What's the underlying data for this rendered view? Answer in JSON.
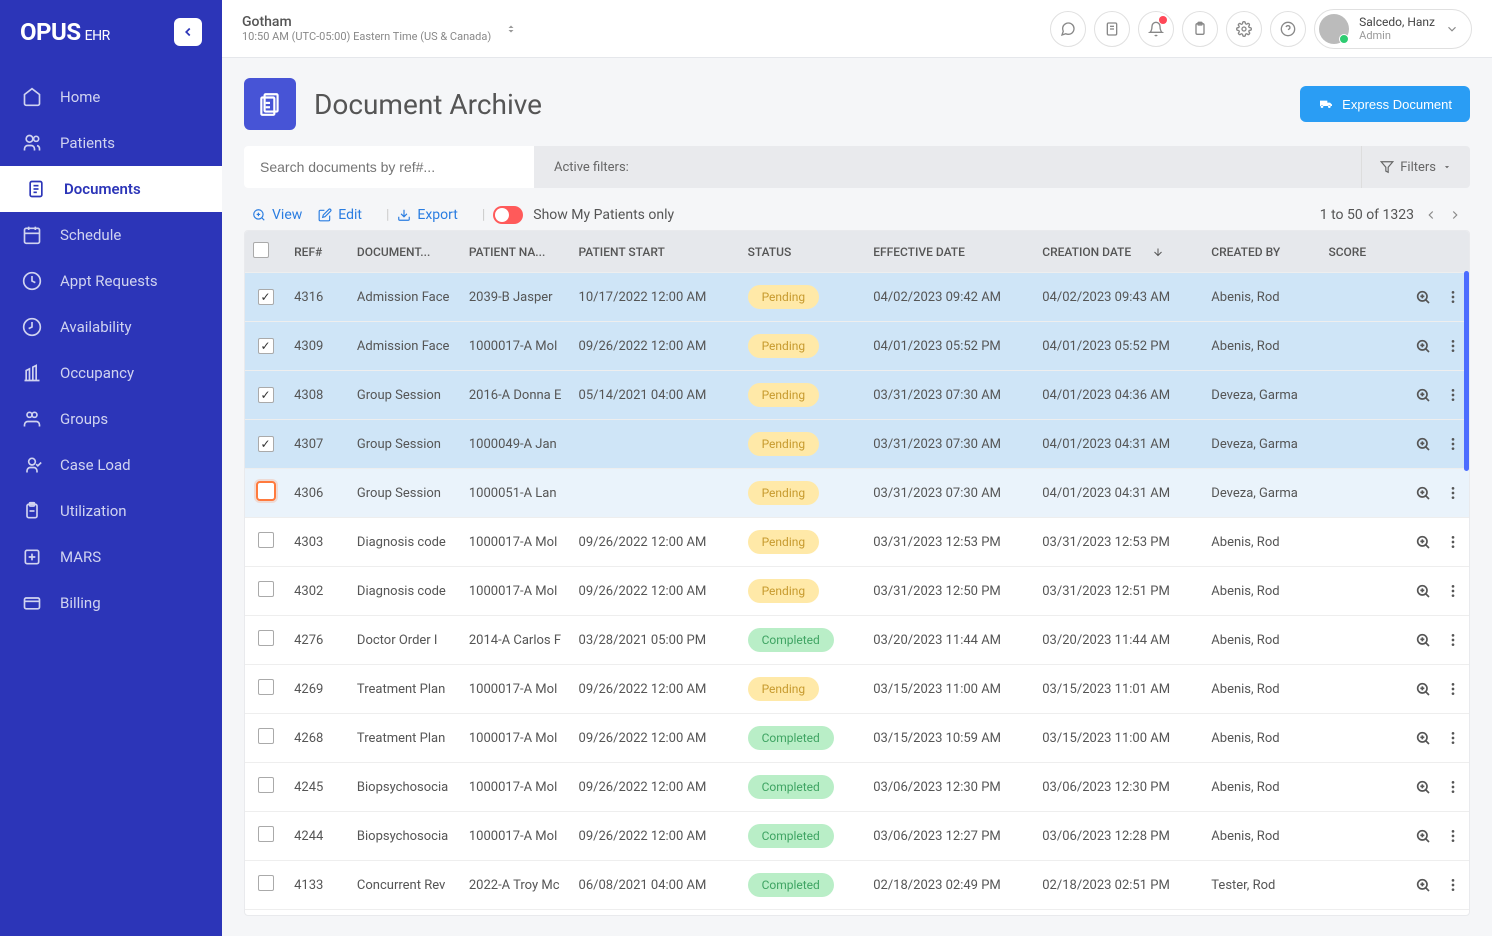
{
  "brand": {
    "name": "OPUS",
    "sub": "EHR"
  },
  "sidebar": {
    "items": [
      {
        "label": "Home"
      },
      {
        "label": "Patients"
      },
      {
        "label": "Documents"
      },
      {
        "label": "Schedule"
      },
      {
        "label": "Appt Requests"
      },
      {
        "label": "Availability"
      },
      {
        "label": "Occupancy"
      },
      {
        "label": "Groups"
      },
      {
        "label": "Case Load"
      },
      {
        "label": "Utilization"
      },
      {
        "label": "MARS"
      },
      {
        "label": "Billing"
      }
    ]
  },
  "topbar": {
    "location": "Gotham",
    "time": "10:50 AM (UTC-05:00) Eastern Time (US & Canada)",
    "user_name": "Salcedo, Hanz",
    "user_role": "Admin"
  },
  "page": {
    "title": "Document Archive",
    "express_btn": "Express Document",
    "search_placeholder": "Search documents by ref#...",
    "active_filters": "Active filters:",
    "filters_btn": "Filters"
  },
  "toolbar": {
    "view": "View",
    "edit": "Edit",
    "export": "Export",
    "toggle_label": "Show My Patients only",
    "pager": "1 to 50 of 1323"
  },
  "columns": {
    "ref": "REF#",
    "doc": "DOCUMENT...",
    "patient": "PATIENT NA...",
    "start": "PATIENT START",
    "status": "STATUS",
    "eff": "EFFECTIVE DATE",
    "creat": "CREATION DATE",
    "by": "CREATED BY",
    "score": "SCORE"
  },
  "rows": [
    {
      "selected": true,
      "ref": "4316",
      "doc": "Admission Face",
      "patient": "2039-B Jasper",
      "start": "10/17/2022 12:00 AM",
      "status": "Pending",
      "eff": "04/02/2023 09:42 AM",
      "creat": "04/02/2023 09:43 AM",
      "by": "Abenis, Rod"
    },
    {
      "selected": true,
      "ref": "4309",
      "doc": "Admission Face",
      "patient": "1000017-A Mol",
      "start": "09/26/2022 12:00 AM",
      "status": "Pending",
      "eff": "04/01/2023 05:52 PM",
      "creat": "04/01/2023 05:52 PM",
      "by": "Abenis, Rod"
    },
    {
      "selected": true,
      "ref": "4308",
      "doc": "Group Session",
      "patient": "2016-A Donna E",
      "start": "05/14/2021 04:00 AM",
      "status": "Pending",
      "eff": "03/31/2023 07:30 AM",
      "creat": "04/01/2023 04:36 AM",
      "by": "Deveza, Garma"
    },
    {
      "selected": true,
      "ref": "4307",
      "doc": "Group Session",
      "patient": "1000049-A Jan",
      "start": "",
      "status": "Pending",
      "eff": "03/31/2023 07:30 AM",
      "creat": "04/01/2023 04:31 AM",
      "by": "Deveza, Garma"
    },
    {
      "selected": false,
      "hl": true,
      "ref": "4306",
      "doc": "Group Session",
      "patient": "1000051-A Lan",
      "start": "",
      "status": "Pending",
      "eff": "03/31/2023 07:30 AM",
      "creat": "04/01/2023 04:31 AM",
      "by": "Deveza, Garma"
    },
    {
      "selected": false,
      "ref": "4303",
      "doc": "Diagnosis code",
      "patient": "1000017-A Mol",
      "start": "09/26/2022 12:00 AM",
      "status": "Pending",
      "eff": "03/31/2023 12:53 PM",
      "creat": "03/31/2023 12:53 PM",
      "by": "Abenis, Rod"
    },
    {
      "selected": false,
      "ref": "4302",
      "doc": "Diagnosis code",
      "patient": "1000017-A Mol",
      "start": "09/26/2022 12:00 AM",
      "status": "Pending",
      "eff": "03/31/2023 12:50 PM",
      "creat": "03/31/2023 12:51 PM",
      "by": "Abenis, Rod"
    },
    {
      "selected": false,
      "ref": "4276",
      "doc": "Doctor Order I",
      "patient": "2014-A Carlos F",
      "start": "03/28/2021 05:00 PM",
      "status": "Completed",
      "eff": "03/20/2023 11:44 AM",
      "creat": "03/20/2023 11:44 AM",
      "by": "Abenis, Rod"
    },
    {
      "selected": false,
      "ref": "4269",
      "doc": "Treatment Plan",
      "patient": "1000017-A Mol",
      "start": "09/26/2022 12:00 AM",
      "status": "Pending",
      "eff": "03/15/2023 11:00 AM",
      "creat": "03/15/2023 11:01 AM",
      "by": "Abenis, Rod"
    },
    {
      "selected": false,
      "ref": "4268",
      "doc": "Treatment Plan",
      "patient": "1000017-A Mol",
      "start": "09/26/2022 12:00 AM",
      "status": "Completed",
      "eff": "03/15/2023 10:59 AM",
      "creat": "03/15/2023 11:00 AM",
      "by": "Abenis, Rod"
    },
    {
      "selected": false,
      "ref": "4245",
      "doc": "Biopsychosocia",
      "patient": "1000017-A Mol",
      "start": "09/26/2022 12:00 AM",
      "status": "Completed",
      "eff": "03/06/2023 12:30 PM",
      "creat": "03/06/2023 12:30 PM",
      "by": "Abenis, Rod"
    },
    {
      "selected": false,
      "ref": "4244",
      "doc": "Biopsychosocia",
      "patient": "1000017-A Mol",
      "start": "09/26/2022 12:00 AM",
      "status": "Completed",
      "eff": "03/06/2023 12:27 PM",
      "creat": "03/06/2023 12:28 PM",
      "by": "Abenis, Rod"
    },
    {
      "selected": false,
      "ref": "4133",
      "doc": "Concurrent Rev",
      "patient": "2022-A Troy Mc",
      "start": "06/08/2021 04:00 AM",
      "status": "Completed",
      "eff": "02/18/2023 02:49 PM",
      "creat": "02/18/2023 02:51 PM",
      "by": "Tester, Rod"
    }
  ]
}
